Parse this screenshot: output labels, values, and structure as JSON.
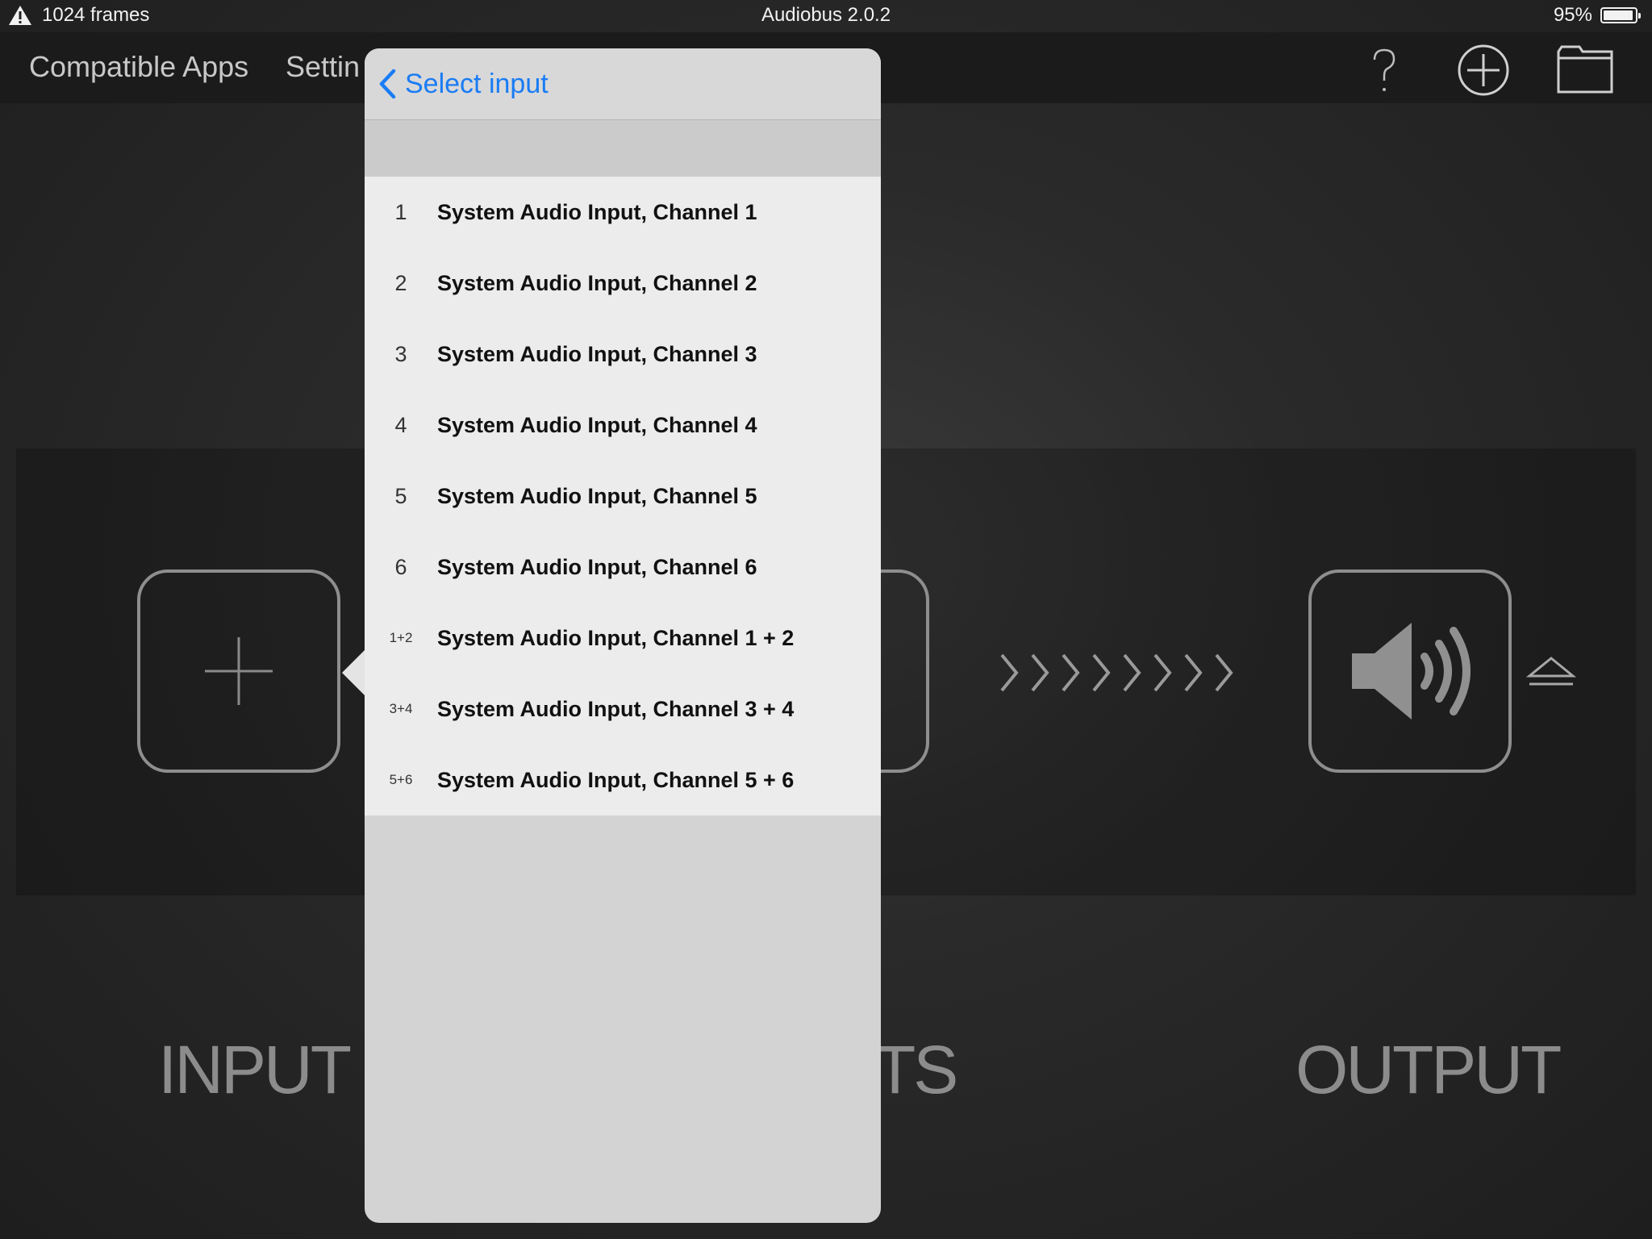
{
  "status_bar": {
    "warning_icon": "warning-triangle-icon",
    "frames": "1024 frames",
    "title": "Audiobus 2.0.2",
    "battery_percent": "95%",
    "battery_level": 0.95
  },
  "nav": {
    "compatible_apps": "Compatible Apps",
    "settings": "Settin",
    "icons": [
      "help-icon",
      "add-circle-icon",
      "folder-icon"
    ]
  },
  "pipeline": {
    "input_label": "INPUT",
    "effects_label_visible": "TS",
    "output_label": "OUTPUT"
  },
  "popover": {
    "back_label": "Select input",
    "items": [
      {
        "num": "1",
        "label": "System Audio Input, Channel 1"
      },
      {
        "num": "2",
        "label": "System Audio Input, Channel 2"
      },
      {
        "num": "3",
        "label": "System Audio Input, Channel 3"
      },
      {
        "num": "4",
        "label": "System Audio Input, Channel 4"
      },
      {
        "num": "5",
        "label": "System Audio Input, Channel 5"
      },
      {
        "num": "6",
        "label": "System Audio Input, Channel 6"
      },
      {
        "num": "1+2",
        "label": "System Audio Input, Channel 1 + 2"
      },
      {
        "num": "3+4",
        "label": "System Audio Input, Channel 3 + 4"
      },
      {
        "num": "5+6",
        "label": "System Audio Input, Channel 5 + 6"
      }
    ]
  },
  "colors": {
    "accent_blue": "#1a7cf5",
    "background": "#2a2a2a",
    "popover_bg": "#ececec"
  }
}
